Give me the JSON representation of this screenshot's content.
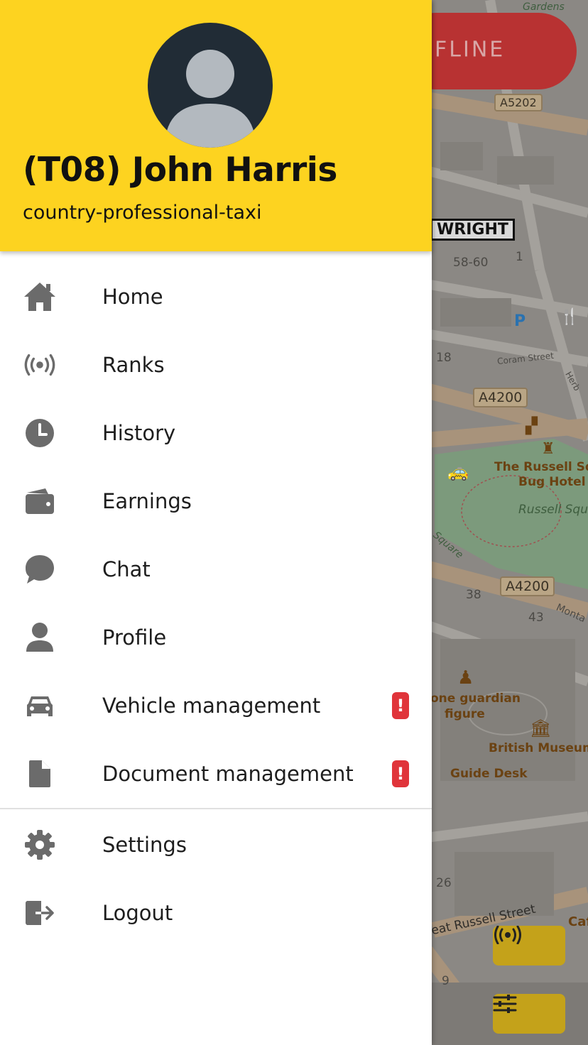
{
  "header": {
    "driver_name": "(T08) John Harris",
    "company": "country-professional-taxi"
  },
  "menu": {
    "items": [
      {
        "label": "Home",
        "icon": "home-icon"
      },
      {
        "label": "Ranks",
        "icon": "broadcast-icon"
      },
      {
        "label": "History",
        "icon": "clock-icon"
      },
      {
        "label": "Earnings",
        "icon": "wallet-icon"
      },
      {
        "label": "Chat",
        "icon": "chat-icon"
      },
      {
        "label": "Profile",
        "icon": "person-icon"
      },
      {
        "label": "Vehicle management",
        "icon": "car-icon",
        "badge": "!"
      },
      {
        "label": "Document management",
        "icon": "document-icon",
        "badge": "!"
      }
    ],
    "secondary": [
      {
        "label": "Settings",
        "icon": "gear-icon"
      },
      {
        "label": "Logout",
        "icon": "logout-icon"
      }
    ]
  },
  "status": {
    "offline_label": "FLINE"
  },
  "map": {
    "labels": {
      "gardens": "Gardens",
      "a5202": "A5202",
      "wright": "WRIGHT",
      "n5860": "58-60",
      "n1": "1",
      "parking": "P",
      "n18": "18",
      "a4200_top": "A4200",
      "hotel_1": "The Russell Squa",
      "hotel_2": "Bug Hotel",
      "russell_sq": "Russell Squa",
      "square": "Square",
      "a4200_bottom": "A4200",
      "n38": "38",
      "n43": "43",
      "guardian_1": "one guardian",
      "guardian_2": "figure",
      "museum": "British Museum",
      "guide_desk": "Guide Desk",
      "n26": "26",
      "street": "eat Russell Street",
      "n9": "9",
      "cafe": "Caf",
      "coram": "Coram Street",
      "montague": "Monta",
      "herbrand": "Herb"
    }
  },
  "colors": {
    "header_yellow": "#fdd320",
    "offline_red": "#b83232",
    "badge_red": "#e0343a",
    "map_button": "#c4a21a",
    "icon_gray": "#6b6b6b"
  }
}
